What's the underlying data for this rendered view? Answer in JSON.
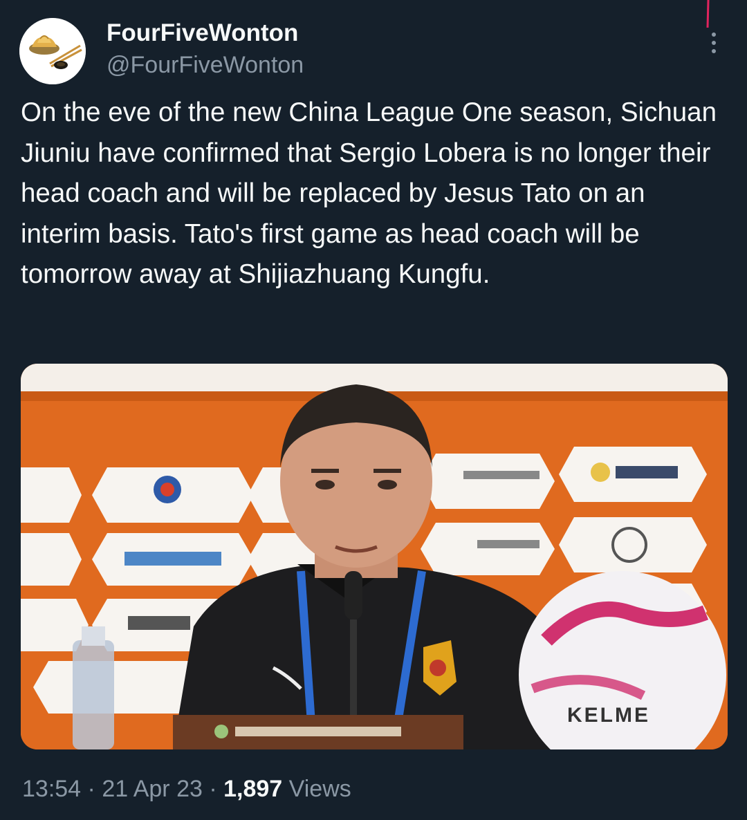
{
  "tweet": {
    "author": {
      "display_name": "FourFiveWonton",
      "handle": "@FourFiveWonton",
      "avatar_icon": "dumplings-chopsticks-icon"
    },
    "menu_icon": "more-vertical-icon",
    "text": "On the eve of the new China League One season, Sichuan Jiuniu have confirmed that Sergio Lobera is no longer their head coach and will be replaced by Jesus Tato on an interim basis. Tato's first game as head coach will be tomorrow away at Shijiazhuang Kungfu.",
    "media": {
      "type": "photo",
      "ball_brand": "KELME"
    },
    "meta": {
      "time": "13:54",
      "separator": "·",
      "date": "21 Apr 23",
      "views_count": "1,897",
      "views_label": "Views"
    }
  },
  "colors": {
    "background": "#15202b",
    "primary_text": "#f7f9f9",
    "secondary_text": "#8b98a5",
    "backdrop_orange": "#e06a1f"
  }
}
